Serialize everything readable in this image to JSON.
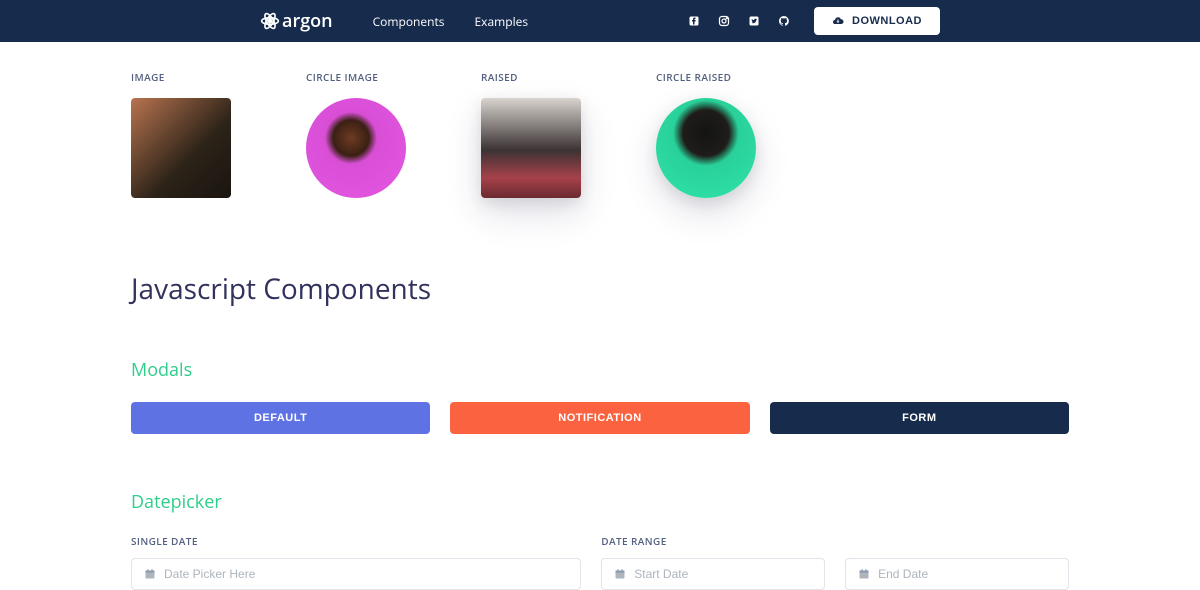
{
  "nav": {
    "brand": "argon",
    "links": [
      "Components",
      "Examples"
    ],
    "download": "DOWNLOAD"
  },
  "images": {
    "image": "IMAGE",
    "circle": "CIRCLE IMAGE",
    "raised": "RAISED",
    "circle_raised": "CIRCLE RAISED"
  },
  "js_title": "Javascript Components",
  "modals": {
    "title": "Modals",
    "default": "DEFAULT",
    "notification": "NOTIFICATION",
    "form": "FORM"
  },
  "datepicker": {
    "title": "Datepicker",
    "single_label": "SINGLE DATE",
    "range_label": "DATE RANGE",
    "single_placeholder": "Date Picker Here",
    "start_placeholder": "Start Date",
    "end_placeholder": "End Date"
  }
}
